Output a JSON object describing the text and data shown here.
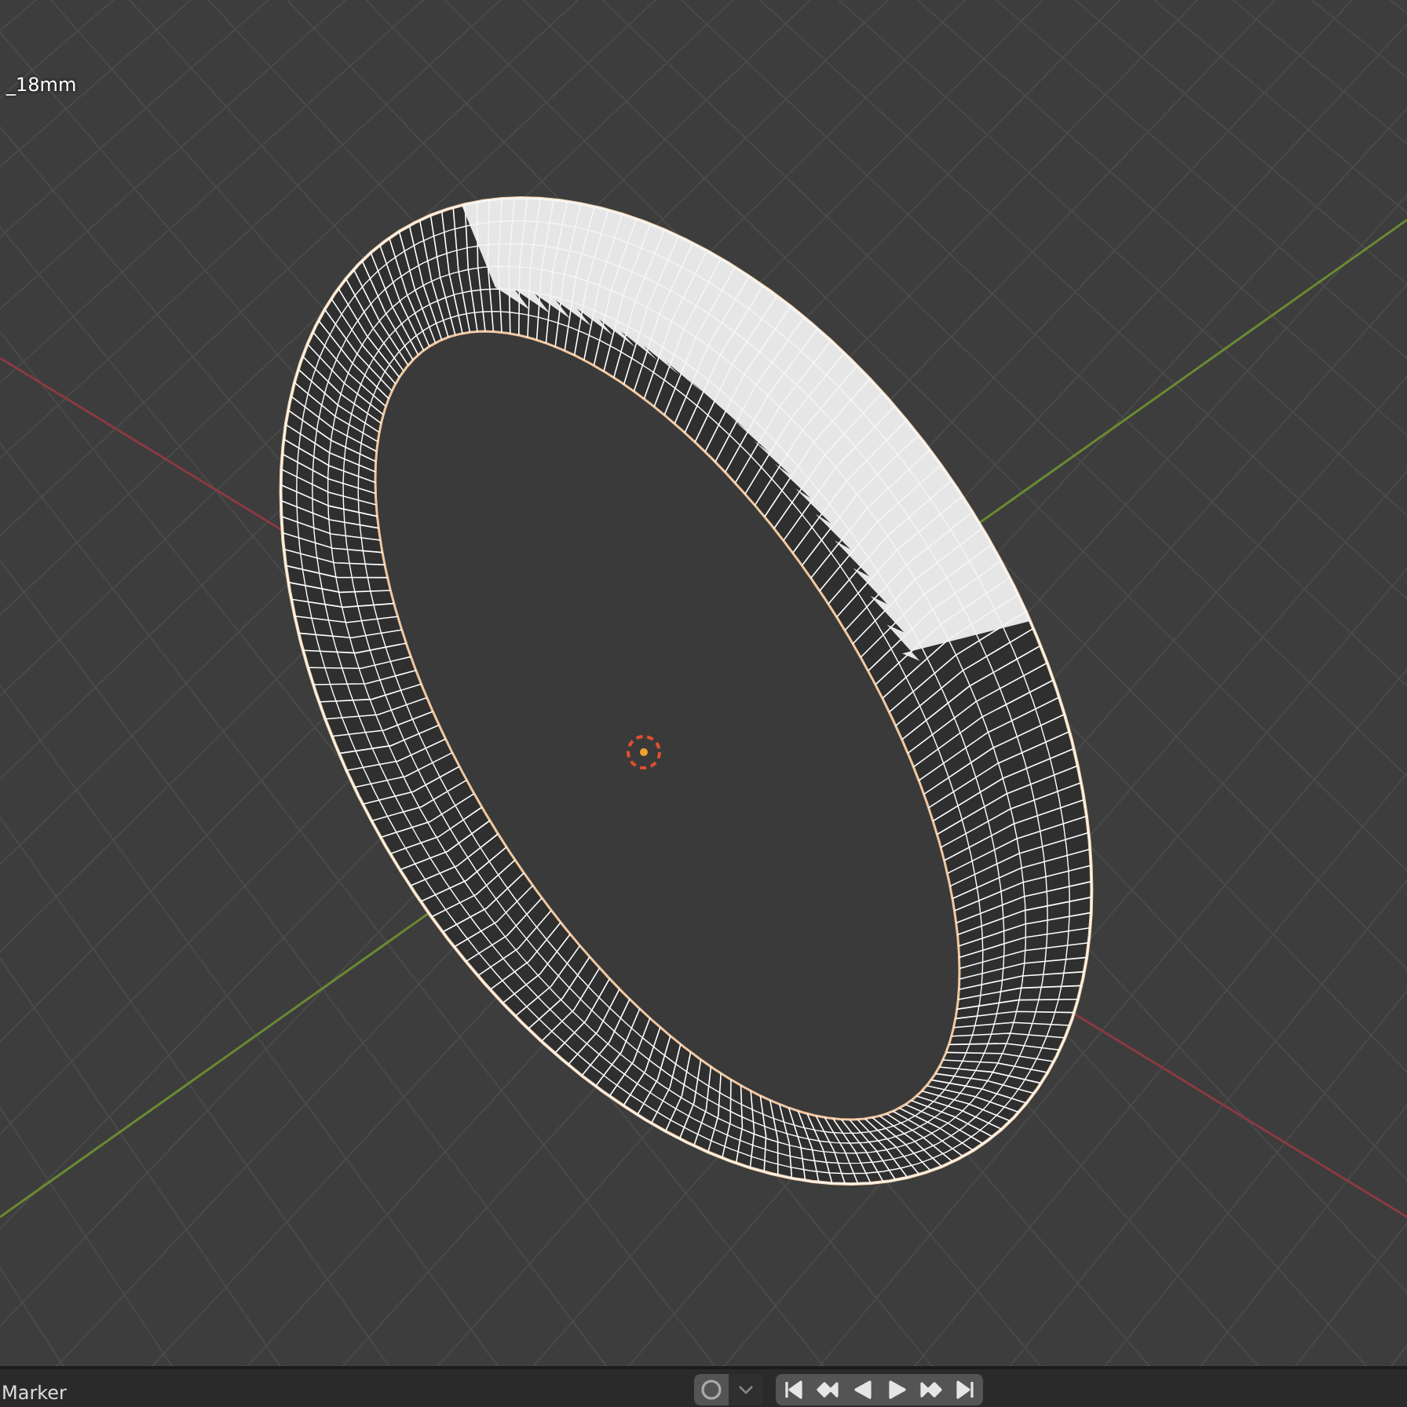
{
  "viewport": {
    "object_label": "_18mm"
  },
  "timeline": {
    "menu_label": "Marker",
    "auto_keying": {
      "on": false
    }
  }
}
